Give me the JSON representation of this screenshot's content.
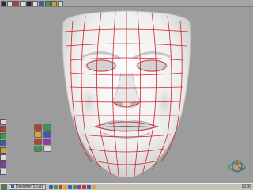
{
  "taskbar": {
    "task_label": "Designer Sculpt",
    "clock": "12:00"
  },
  "colors": {
    "background": "#9a9a9a",
    "mesh_line": "#d0242a",
    "surface": "#f1f1f1"
  }
}
